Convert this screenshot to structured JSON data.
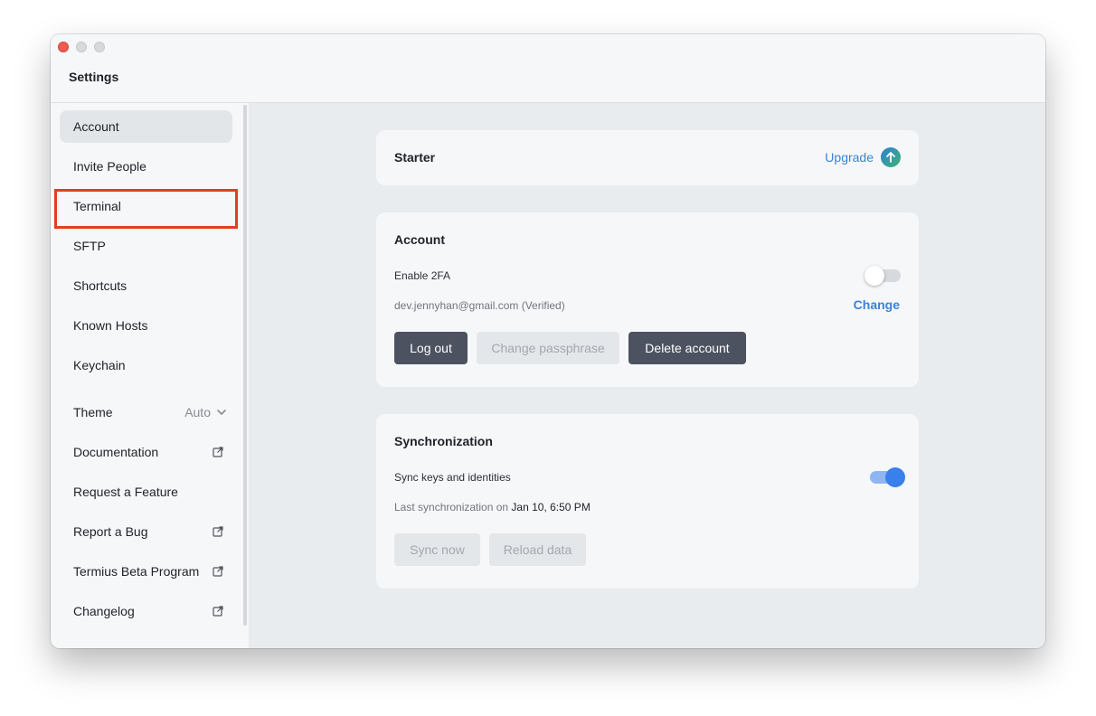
{
  "window": {
    "title": "Settings"
  },
  "sidebar": {
    "items": [
      {
        "label": "Account",
        "active": true
      },
      {
        "label": "Invite People"
      },
      {
        "label": "Terminal"
      },
      {
        "label": "SFTP"
      },
      {
        "label": "Shortcuts"
      },
      {
        "label": "Known Hosts"
      },
      {
        "label": "Keychain"
      }
    ],
    "theme": {
      "label": "Theme",
      "value": "Auto"
    },
    "links": [
      {
        "label": "Documentation",
        "icon": "external-link-icon"
      },
      {
        "label": "Request a Feature"
      },
      {
        "label": "Report a Bug",
        "icon": "external-link-icon"
      },
      {
        "label": "Termius Beta Program",
        "icon": "external-link-icon"
      },
      {
        "label": "Changelog",
        "icon": "external-link-icon"
      }
    ]
  },
  "plan_card": {
    "title": "Starter",
    "upgrade_label": "Upgrade",
    "upgrade_icon": "arrow-up-circle-icon"
  },
  "account_card": {
    "title": "Account",
    "twofa_label": "Enable 2FA",
    "twofa_enabled": false,
    "email": "dev.jennyhan@gmail.com (Verified)",
    "change_label": "Change",
    "buttons": {
      "logout": "Log out",
      "change_passphrase": "Change passphrase",
      "delete": "Delete account"
    }
  },
  "sync_card": {
    "title": "Synchronization",
    "sync_label": "Sync keys and identities",
    "sync_enabled": true,
    "last_sync_prefix": "Last synchronization on",
    "last_sync_time": "Jan 10, 6:50 PM",
    "buttons": {
      "sync_now": "Sync now",
      "reload": "Reload data"
    }
  },
  "colors": {
    "accent": "#3b82d8",
    "toggle_on": "#3a80ea",
    "dark_button": "#4d5260",
    "highlight": "#e0401f"
  }
}
